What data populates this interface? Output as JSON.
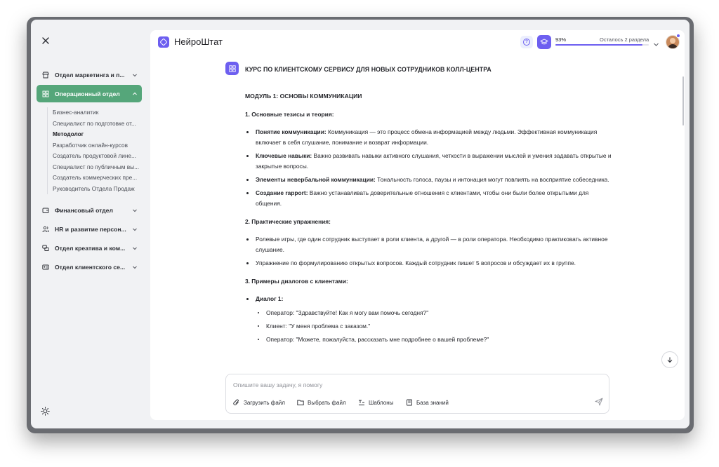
{
  "app": {
    "brand": "НейроШтат"
  },
  "sidebar": {
    "departments": [
      {
        "label": "Отдел маркетинга и п...",
        "icon": "store-icon",
        "expanded": false
      },
      {
        "label": "Операционный отдел",
        "icon": "grid-icon",
        "expanded": true,
        "active": true
      },
      {
        "label": "Финансовый отдел",
        "icon": "wallet-icon",
        "expanded": false
      },
      {
        "label": "HR и развитие персон...",
        "icon": "people-icon",
        "expanded": false
      },
      {
        "label": "Отдел креатива и ком...",
        "icon": "chat-icon",
        "expanded": false
      },
      {
        "label": "Отдел клиентского се...",
        "icon": "id-card-icon",
        "expanded": false
      }
    ],
    "subitems": [
      {
        "label": "Бизнес-аналитик"
      },
      {
        "label": "Специалист по подготовке от..."
      },
      {
        "label": "Методолог",
        "selected": true
      },
      {
        "label": "Разработчик онлайн-курсов"
      },
      {
        "label": "Создатель продуктовой лине..."
      },
      {
        "label": "Специалист по публичным вы..."
      },
      {
        "label": "Создатель коммерческих пре..."
      },
      {
        "label": "Руководитель Отдела Продаж"
      }
    ]
  },
  "header": {
    "progress_percent_label": "93%",
    "progress_value": 0.93,
    "remaining_label": "Осталось 2 раздела",
    "accent_color": "#6d5ff0"
  },
  "content": {
    "title": "КУРС ПО КЛИЕНТСКОМУ СЕРВИСУ ДЛЯ НОВЫХ СОТРУДНИКОВ КОЛЛ-ЦЕНТРА",
    "module": "МОДУЛЬ 1: ОСНОВЫ КОММУНИКАЦИИ",
    "section1": {
      "heading": "1. Основные тезисы и теория:",
      "items": [
        {
          "term": "Понятие коммуникации:",
          "text": " Коммуникация — это процесс обмена информацией между людьми. Эффективная коммуникация включает в себя слушание, понимание и возврат информации."
        },
        {
          "term": "Ключевые навыки:",
          "text": " Важно развивать навыки активного слушания, четкости в выражении мыслей и умения задавать открытые и закрытые вопросы."
        },
        {
          "term": "Элементы невербальной коммуникации:",
          "text": " Тональность голоса, паузы и интонация могут повлиять на восприятие собеседника."
        },
        {
          "term": "Создание rapport:",
          "text": " Важно устанавливать доверительные отношения с клиентами, чтобы они были более открытыми для общения."
        }
      ]
    },
    "section2": {
      "heading": "2. Практические упражнения:",
      "items": [
        {
          "text": "Ролевые игры, где один сотрудник выступает в роли клиента, а другой — в роли оператора. Необходимо практиковать активное слушание."
        },
        {
          "text": "Упражнение по формулированию открытых вопросов. Каждый сотрудник пишет 5 вопросов и обсуждает их в группе."
        }
      ]
    },
    "section3": {
      "heading": "3. Примеры диалогов с клиентами:",
      "dialog_title": "Диалог 1:",
      "lines": [
        {
          "text": "Оператор: \"Здравствуйте! Как я могу вам помочь сегодня?\""
        },
        {
          "text": "Клиент: \"У меня проблема с заказом.\""
        },
        {
          "text": "Оператор: \"Можете, пожалуйста, рассказать мне подробнее о вашей проблеме?\""
        }
      ]
    }
  },
  "composer": {
    "placeholder": "Опишите вашу задачу, я помогу",
    "value": "",
    "upload_label": "Загрузить файл",
    "choose_label": "Выбрать файл",
    "templates_label": "Шаблоны",
    "kb_label": "База знаний"
  }
}
